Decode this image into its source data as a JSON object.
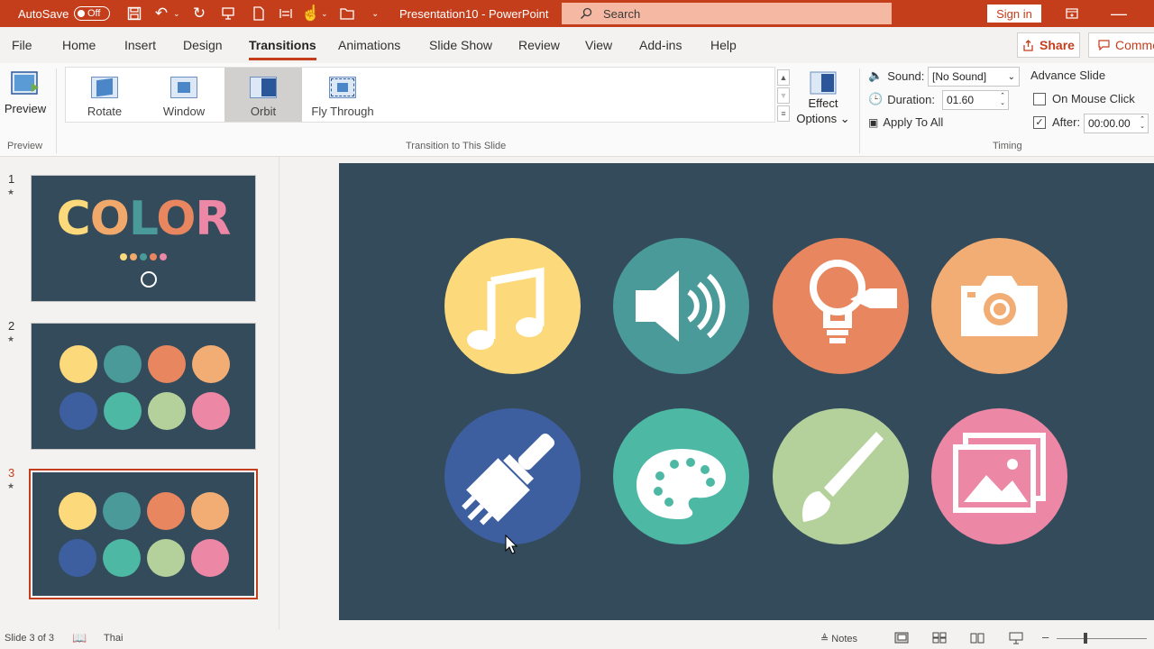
{
  "titlebar": {
    "autosave_label": "AutoSave",
    "autosave_state": "Off",
    "doc_title": "Presentation10  -  PowerPoint",
    "search_placeholder": "Search",
    "signin_label": "Sign in",
    "accent": "#c43e1c"
  },
  "menu": {
    "tabs": [
      "File",
      "Home",
      "Insert",
      "Design",
      "Transitions",
      "Animations",
      "Slide Show",
      "Review",
      "View",
      "Add-ins",
      "Help"
    ],
    "active": "Transitions",
    "share_label": "Share",
    "comments_label": "Comme"
  },
  "ribbon": {
    "preview_label": "Preview",
    "preview_group": "Preview",
    "transitions": [
      "Rotate",
      "Window",
      "Orbit",
      "Fly Through"
    ],
    "selected_transition": "Orbit",
    "transition_group": "Transition to This Slide",
    "effect_options": [
      "Effect",
      "Options"
    ],
    "sound_label": "Sound:",
    "sound_value": "[No Sound]",
    "duration_label": "Duration:",
    "duration_value": "01.60",
    "apply_all": "Apply To All",
    "advance_slide": "Advance Slide",
    "on_mouse_click": "On Mouse Click",
    "on_mouse_click_checked": false,
    "after_label": "After:",
    "after_checked": true,
    "after_value": "00:00.00",
    "timing_group": "Timing"
  },
  "slides": [
    {
      "number": "1",
      "title_letters": [
        "C",
        "O",
        "L",
        "O",
        "R"
      ],
      "letter_colors": [
        "#fcd97a",
        "#f0a86b",
        "#4a9a9a",
        "#e8865f",
        "#ec87a6"
      ]
    },
    {
      "number": "2"
    },
    {
      "number": "3",
      "selected": true
    }
  ],
  "circle_colors": [
    "#fcd97a",
    "#4a9a9a",
    "#e8865f",
    "#f2ad74",
    "#3d5fa0",
    "#4db8a3",
    "#b5d19b",
    "#ec87a6"
  ],
  "circle_icons": [
    "music-note-icon",
    "speaker-icon",
    "lightbulb-icon",
    "camera-icon",
    "paint-brush-icon",
    "palette-icon",
    "brush-icon",
    "image-icon"
  ],
  "slide_bg": "#344b5b",
  "status": {
    "slide_info": "Slide 3 of 3",
    "language": "Thai",
    "notes_label": "Notes"
  }
}
